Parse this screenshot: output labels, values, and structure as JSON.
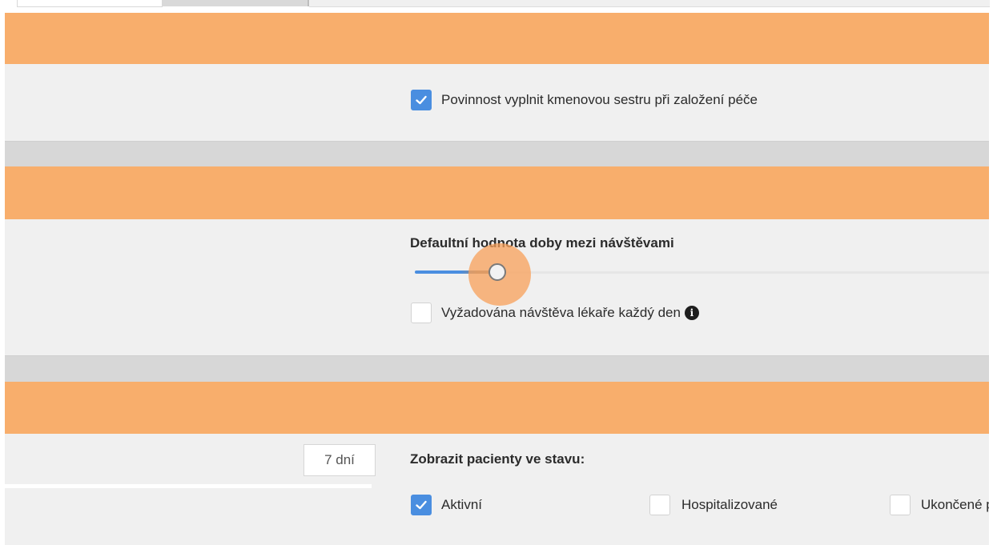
{
  "section1": {
    "required_nurse_label": "Povinnost vyplnit kmenovou sestru při založení péče",
    "required_nurse_checked": true
  },
  "section2": {
    "interval_label": "Defaultní hodnota doby mezi návštěvami",
    "doctor_daily_label": "Vyžadována návštěva lékaře každý den",
    "doctor_daily_checked": false,
    "info_icon": "info-icon"
  },
  "section3": {
    "days_value": "7 dní",
    "show_patients_label": "Zobrazit pacienty ve stavu:",
    "states": [
      {
        "label": "Aktivní",
        "checked": true
      },
      {
        "label": "Hospitalizované",
        "checked": false
      },
      {
        "label": "Ukončené p",
        "checked": false
      }
    ]
  },
  "colors": {
    "section_header": "#f8ae6c",
    "accent": "#4a8ee0",
    "panel": "#f0f0f0"
  }
}
